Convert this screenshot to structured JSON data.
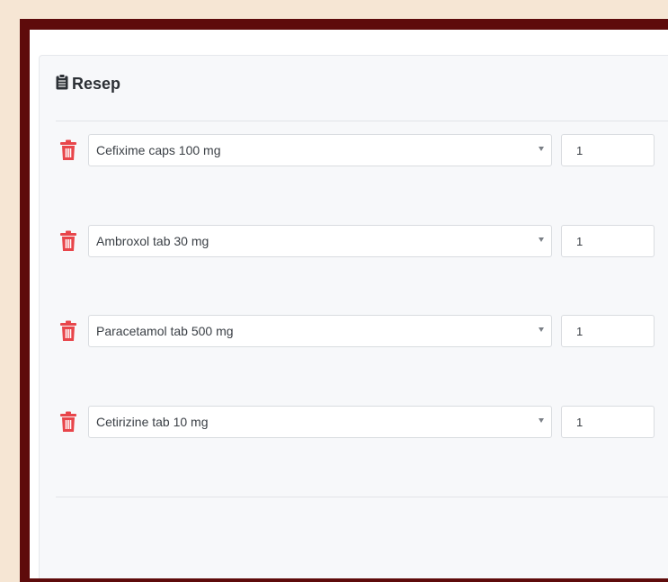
{
  "recipe": {
    "title": "Resep",
    "items": [
      {
        "drug": "Cefixime caps 100 mg",
        "qty": "1"
      },
      {
        "drug": "Ambroxol tab 30 mg",
        "qty": "1"
      },
      {
        "drug": "Paracetamol tab 500 mg",
        "qty": "1"
      },
      {
        "drug": "Cetirizine tab 10 mg",
        "qty": "1"
      }
    ]
  },
  "colors": {
    "trash": "#e8454a",
    "frame": "#5e0b0b",
    "background": "#f6e6d4"
  },
  "icons": {
    "header": "clipboard-icon",
    "row_action": "trash-icon",
    "select_indicator": "caret-down-icon"
  }
}
